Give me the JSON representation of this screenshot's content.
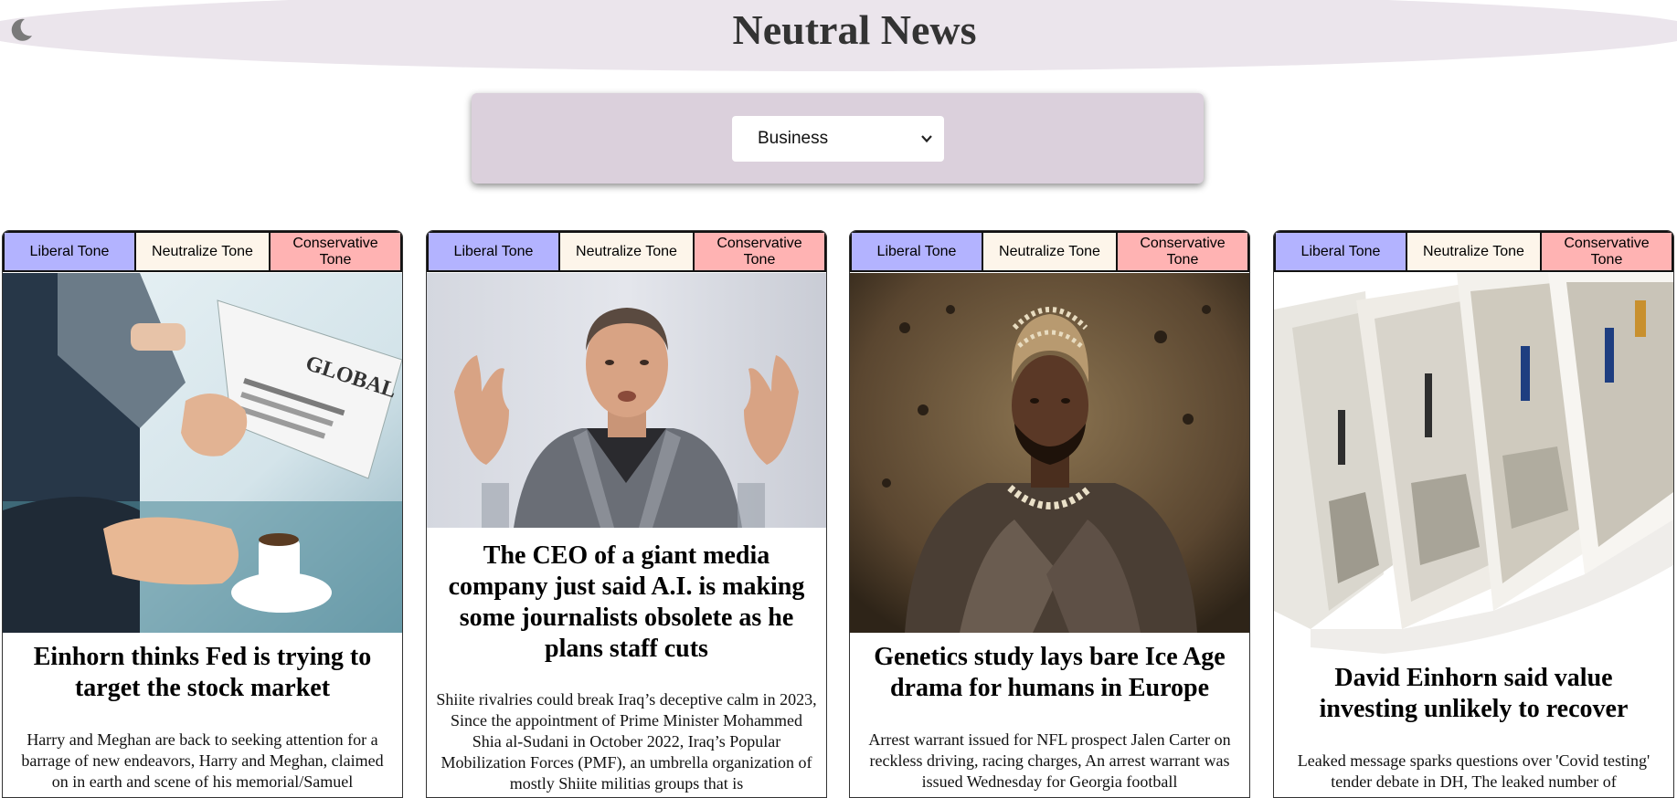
{
  "header": {
    "title": "Neutral News",
    "theme_toggle_icon": "moon-icon"
  },
  "filter": {
    "selected": "Business",
    "dropdown_icon": "chevron-down-icon"
  },
  "tone_buttons": {
    "liberal": "Liberal Tone",
    "neutral": "Neutralize Tone",
    "conservative": "Conservative Tone"
  },
  "colors": {
    "liberal": "#b3b3ff",
    "neutral": "#fdf5ea",
    "conservative": "#ffb3b3",
    "header_bg": "#ebe5ec",
    "panel_bg": "#dbd0dc"
  },
  "articles": [
    {
      "title": "Einhorn thinks Fed is trying to target the stock market",
      "summary": "Harry and Meghan are back to seeking attention for a barrage of new endeavors, Harry and Meghan, claimed on in earth and scene of his memorial/Samuel"
    },
    {
      "title": "The CEO of a giant media company just said A.I. is making some journalists obsolete as he plans staff cuts",
      "summary": "Shiite rivalries could break Iraq’s deceptive calm in 2023, Since the appointment of Prime Minister Mohammed Shia al-Sudani in October 2022, Iraq’s Popular Mobilization Forces (PMF), an umbrella organization of mostly Shiite militias groups that is"
    },
    {
      "title": "Genetics study lays bare Ice Age drama for humans in Europe",
      "summary": "Arrest warrant issued for NFL prospect Jalen Carter on reckless driving, racing charges, An arrest warrant was issued Wednesday for Georgia football"
    },
    {
      "title": "David Einhorn said value investing unlikely to recover",
      "summary": "Leaked message sparks questions over 'Covid testing' tender debate in DH, The leaked number of"
    }
  ]
}
